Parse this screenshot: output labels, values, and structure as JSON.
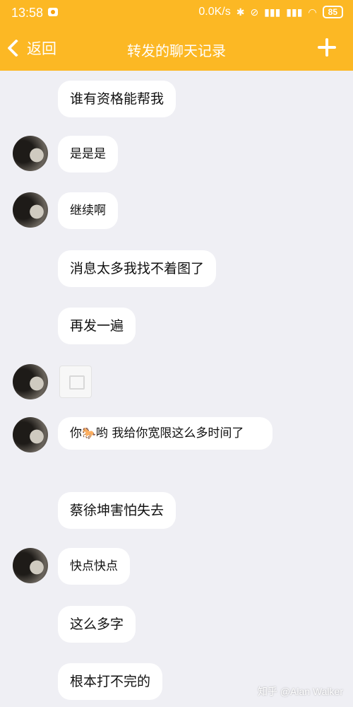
{
  "status_bar": {
    "time": "13:58",
    "net_speed": "0.0K/s",
    "icons": [
      "eye-icon",
      "bluetooth-icon",
      "alarm-off-icon",
      "signal-icon",
      "signal-icon",
      "wifi-icon"
    ],
    "battery": "85"
  },
  "header": {
    "back_label": "返回",
    "title": "转发的聊天记录",
    "accent_color": "#fcb824"
  },
  "messages": [
    {
      "text": "谁有资格能帮我",
      "avatar": false
    },
    {
      "text": "是是是",
      "avatar": true
    },
    {
      "text": "继续啊",
      "avatar": true
    },
    {
      "text": "消息太多我找不着图了",
      "avatar": false
    },
    {
      "text": "再发一遍",
      "avatar": false
    },
    {
      "text": "",
      "avatar": true,
      "image": "image-placeholder-icon"
    },
    {
      "text_before": "你",
      "emoji": "🐎",
      "text_after": "哟 我给你宽限这么多时间了",
      "avatar": true
    },
    {
      "text": "蔡徐坤害怕失去",
      "avatar": false
    },
    {
      "text": "快点快点",
      "avatar": true
    },
    {
      "text": "这么多字",
      "avatar": false
    },
    {
      "text": "根本打不完的",
      "avatar": false
    }
  ],
  "watermark": "知乎 @Alan Walker"
}
